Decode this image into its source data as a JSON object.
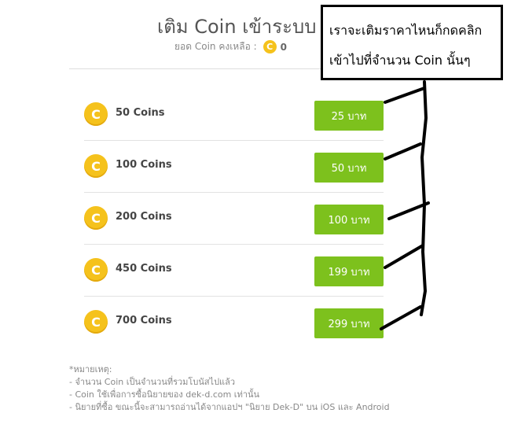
{
  "header": {
    "title": "เติม Coin เข้าระบบ",
    "balance_label": "ยอด Coin คงเหลือ :",
    "balance_value": "0",
    "coin_symbol": "C"
  },
  "packages": [
    {
      "label": "50 Coins",
      "price": "25 บาท"
    },
    {
      "label": "100 Coins",
      "price": "50 บาท"
    },
    {
      "label": "200 Coins",
      "price": "100 บาท"
    },
    {
      "label": "450 Coins",
      "price": "199 บาท"
    },
    {
      "label": "700 Coins",
      "price": "299 บาท"
    }
  ],
  "notes": {
    "heading": "*หมายเหตุ:",
    "lines": [
      "- จำนวน Coin เป็นจำนวนที่รวมโบนัสไปแล้ว",
      "- Coin ใช้เพื่อการซื้อนิยายของ dek-d.com เท่านั้น",
      "- นิยายที่ซื้อ ขณะนี้จะสามารถอ่านได้จากแอปฯ \"นิยาย Dek-D\" บน iOS และ Android"
    ]
  },
  "annotation": {
    "line1": "เราจะเติมราคาไหนก็กดคลิก",
    "line2": "เข้าไปที่จำนวน   Coin นั้นๆ"
  },
  "colors": {
    "button_green": "#7dc11d",
    "coin_gold": "#f5c21c"
  }
}
